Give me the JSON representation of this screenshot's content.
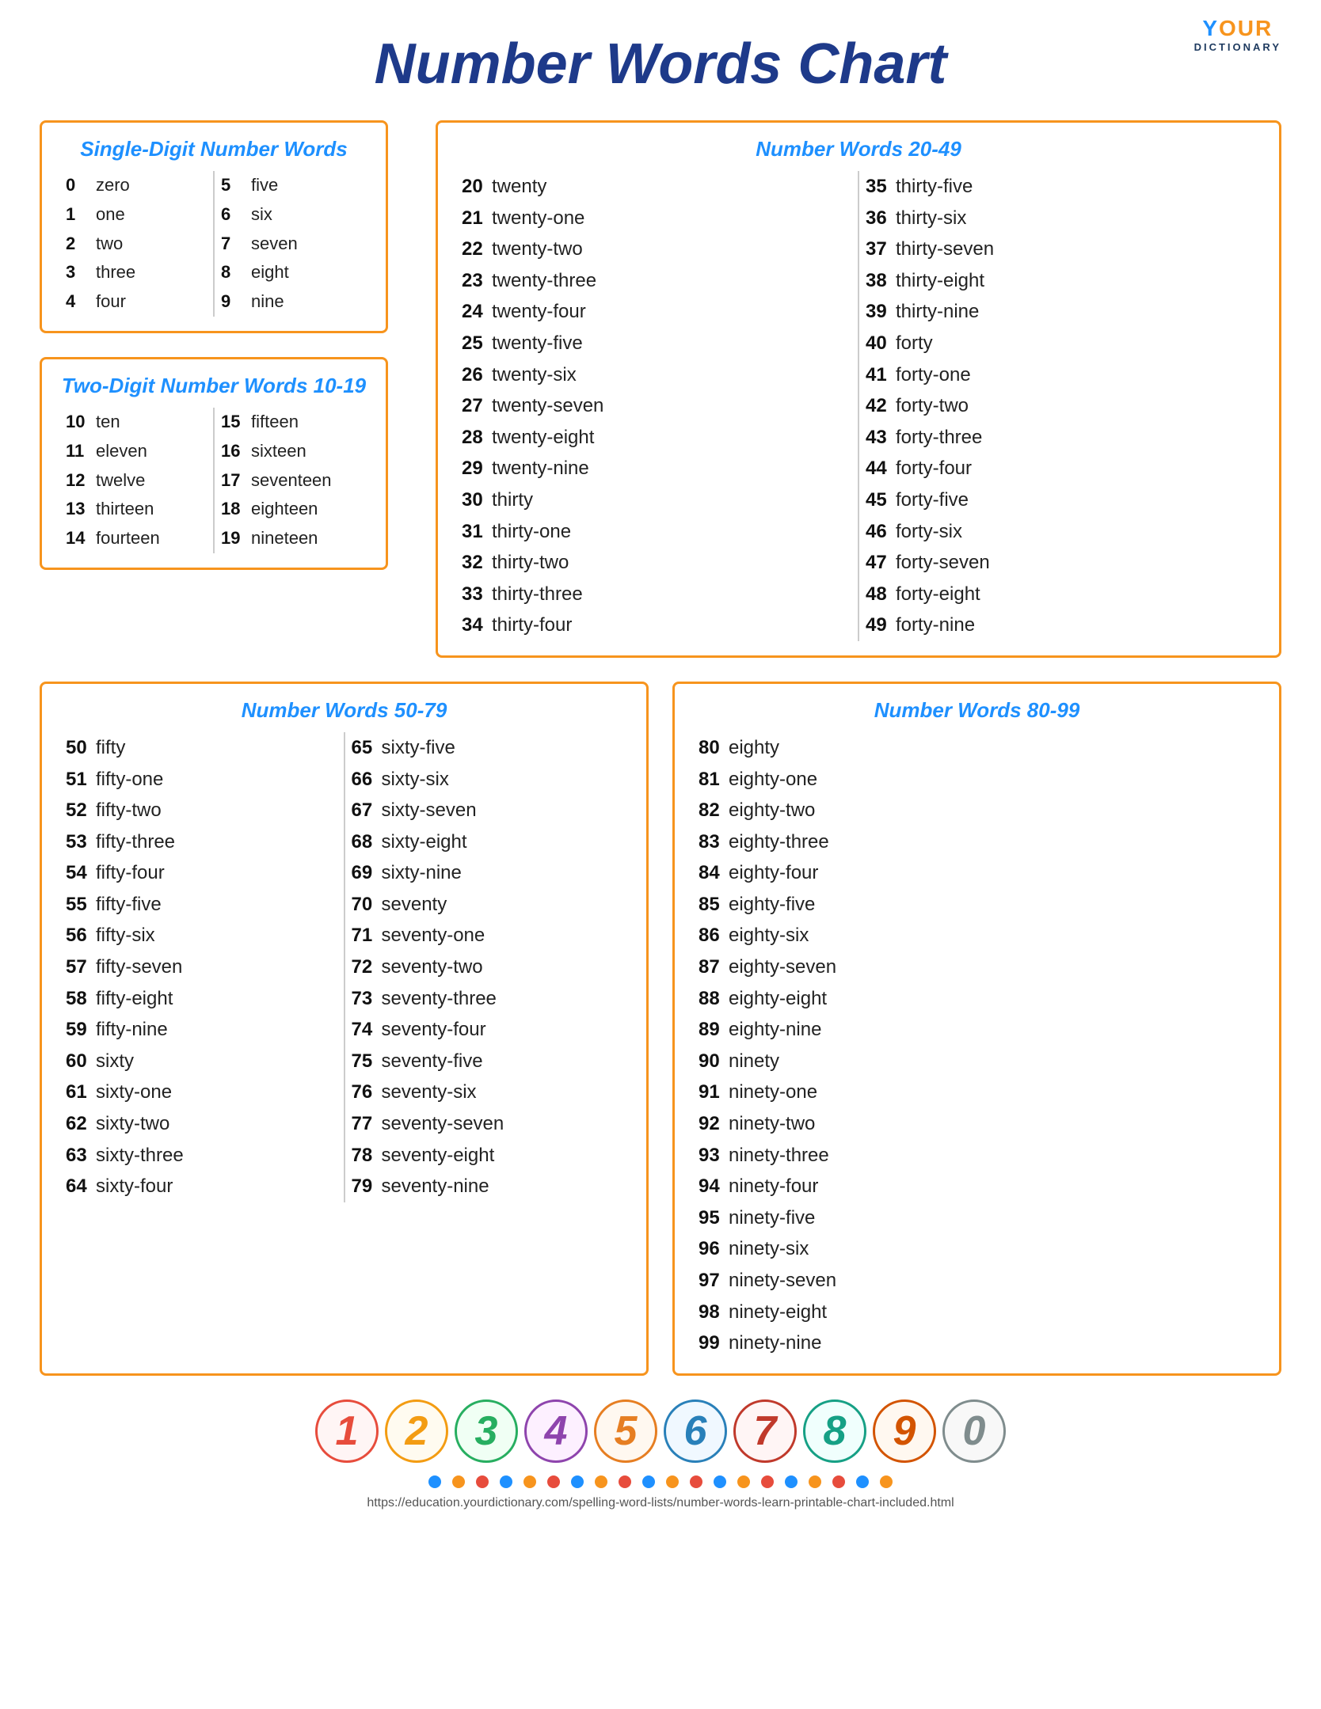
{
  "logo": {
    "your": "Y",
    "our": "OUR",
    "dictionary": "DICTIONARY"
  },
  "title": "Number Words Chart",
  "panels": {
    "single_digit": {
      "title": "Single-Digit Number Words",
      "left_col": [
        {
          "num": "0",
          "word": "zero"
        },
        {
          "num": "1",
          "word": "one"
        },
        {
          "num": "2",
          "word": "two"
        },
        {
          "num": "3",
          "word": "three"
        },
        {
          "num": "4",
          "word": "four"
        }
      ],
      "right_col": [
        {
          "num": "5",
          "word": "five"
        },
        {
          "num": "6",
          "word": "six"
        },
        {
          "num": "7",
          "word": "seven"
        },
        {
          "num": "8",
          "word": "eight"
        },
        {
          "num": "9",
          "word": "nine"
        }
      ]
    },
    "two_digit": {
      "title": "Two-Digit Number Words 10-19",
      "left_col": [
        {
          "num": "10",
          "word": "ten"
        },
        {
          "num": "11",
          "word": "eleven"
        },
        {
          "num": "12",
          "word": "twelve"
        },
        {
          "num": "13",
          "word": "thirteen"
        },
        {
          "num": "14",
          "word": "fourteen"
        }
      ],
      "right_col": [
        {
          "num": "15",
          "word": "fifteen"
        },
        {
          "num": "16",
          "word": "sixteen"
        },
        {
          "num": "17",
          "word": "seventeen"
        },
        {
          "num": "18",
          "word": "eighteen"
        },
        {
          "num": "19",
          "word": "nineteen"
        }
      ]
    },
    "range_2049": {
      "title": "Number Words 20-49",
      "left_col": [
        {
          "num": "20",
          "word": "twenty"
        },
        {
          "num": "21",
          "word": "twenty-one"
        },
        {
          "num": "22",
          "word": "twenty-two"
        },
        {
          "num": "23",
          "word": "twenty-three"
        },
        {
          "num": "24",
          "word": "twenty-four"
        },
        {
          "num": "25",
          "word": "twenty-five"
        },
        {
          "num": "26",
          "word": "twenty-six"
        },
        {
          "num": "27",
          "word": "twenty-seven"
        },
        {
          "num": "28",
          "word": "twenty-eight"
        },
        {
          "num": "29",
          "word": "twenty-nine"
        },
        {
          "num": "30",
          "word": "thirty"
        },
        {
          "num": "31",
          "word": "thirty-one"
        },
        {
          "num": "32",
          "word": "thirty-two"
        },
        {
          "num": "33",
          "word": "thirty-three"
        },
        {
          "num": "34",
          "word": "thirty-four"
        }
      ],
      "right_col": [
        {
          "num": "35",
          "word": "thirty-five"
        },
        {
          "num": "36",
          "word": "thirty-six"
        },
        {
          "num": "37",
          "word": "thirty-seven"
        },
        {
          "num": "38",
          "word": "thirty-eight"
        },
        {
          "num": "39",
          "word": "thirty-nine"
        },
        {
          "num": "40",
          "word": "forty"
        },
        {
          "num": "41",
          "word": "forty-one"
        },
        {
          "num": "42",
          "word": "forty-two"
        },
        {
          "num": "43",
          "word": "forty-three"
        },
        {
          "num": "44",
          "word": "forty-four"
        },
        {
          "num": "45",
          "word": "forty-five"
        },
        {
          "num": "46",
          "word": "forty-six"
        },
        {
          "num": "47",
          "word": "forty-seven"
        },
        {
          "num": "48",
          "word": "forty-eight"
        },
        {
          "num": "49",
          "word": "forty-nine"
        }
      ]
    },
    "range_5079": {
      "title": "Number Words 50-79",
      "left_col": [
        {
          "num": "50",
          "word": "fifty"
        },
        {
          "num": "51",
          "word": "fifty-one"
        },
        {
          "num": "52",
          "word": "fifty-two"
        },
        {
          "num": "53",
          "word": "fifty-three"
        },
        {
          "num": "54",
          "word": "fifty-four"
        },
        {
          "num": "55",
          "word": "fifty-five"
        },
        {
          "num": "56",
          "word": "fifty-six"
        },
        {
          "num": "57",
          "word": "fifty-seven"
        },
        {
          "num": "58",
          "word": "fifty-eight"
        },
        {
          "num": "59",
          "word": "fifty-nine"
        },
        {
          "num": "60",
          "word": "sixty"
        },
        {
          "num": "61",
          "word": "sixty-one"
        },
        {
          "num": "62",
          "word": "sixty-two"
        },
        {
          "num": "63",
          "word": "sixty-three"
        },
        {
          "num": "64",
          "word": "sixty-four"
        }
      ],
      "right_col": [
        {
          "num": "65",
          "word": "sixty-five"
        },
        {
          "num": "66",
          "word": "sixty-six"
        },
        {
          "num": "67",
          "word": "sixty-seven"
        },
        {
          "num": "68",
          "word": "sixty-eight"
        },
        {
          "num": "69",
          "word": "sixty-nine"
        },
        {
          "num": "70",
          "word": "seventy"
        },
        {
          "num": "71",
          "word": "seventy-one"
        },
        {
          "num": "72",
          "word": "seventy-two"
        },
        {
          "num": "73",
          "word": "seventy-three"
        },
        {
          "num": "74",
          "word": "seventy-four"
        },
        {
          "num": "75",
          "word": "seventy-five"
        },
        {
          "num": "76",
          "word": "seventy-six"
        },
        {
          "num": "77",
          "word": "seventy-seven"
        },
        {
          "num": "78",
          "word": "seventy-eight"
        },
        {
          "num": "79",
          "word": "seventy-nine"
        }
      ]
    },
    "range_8099": {
      "title": "Number Words 80-99",
      "left_col": [
        {
          "num": "80",
          "word": "eighty"
        },
        {
          "num": "81",
          "word": "eighty-one"
        },
        {
          "num": "82",
          "word": "eighty-two"
        },
        {
          "num": "83",
          "word": "eighty-three"
        },
        {
          "num": "84",
          "word": "eighty-four"
        },
        {
          "num": "85",
          "word": "eighty-five"
        },
        {
          "num": "86",
          "word": "eighty-six"
        },
        {
          "num": "87",
          "word": "eighty-seven"
        },
        {
          "num": "88",
          "word": "eighty-eight"
        },
        {
          "num": "89",
          "word": "eighty-nine"
        },
        {
          "num": "90",
          "word": "ninety"
        },
        {
          "num": "91",
          "word": "ninety-one"
        },
        {
          "num": "92",
          "word": "ninety-two"
        },
        {
          "num": "93",
          "word": "ninety-three"
        },
        {
          "num": "94",
          "word": "ninety-four"
        },
        {
          "num": "95",
          "word": "ninety-five"
        },
        {
          "num": "96",
          "word": "ninety-six"
        },
        {
          "num": "97",
          "word": "ninety-seven"
        },
        {
          "num": "98",
          "word": "ninety-eight"
        },
        {
          "num": "99",
          "word": "ninety-nine"
        }
      ]
    }
  },
  "deco_numbers": [
    "1",
    "2",
    "3",
    "4",
    "5",
    "6",
    "7",
    "8",
    "9",
    "0"
  ],
  "footer_url": "https://education.yourdictionary.com/spelling-word-lists/number-words-learn-printable-chart-included.html"
}
